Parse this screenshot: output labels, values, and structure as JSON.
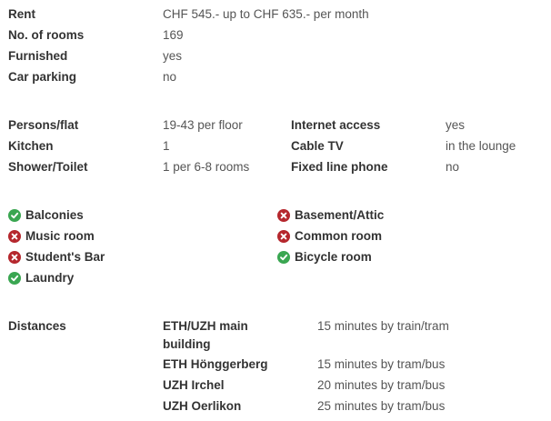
{
  "details": {
    "rent_label": "Rent",
    "rent_value": "CHF 545.- up to CHF 635.- per month",
    "rooms_label": "No. of rooms",
    "rooms_value": "169",
    "furnished_label": "Furnished",
    "furnished_value": "yes",
    "parking_label": "Car parking",
    "parking_value": "no"
  },
  "facilities": {
    "persons_label": "Persons/flat",
    "persons_value": "19-43 per floor",
    "kitchen_label": "Kitchen",
    "kitchen_value": "1",
    "shower_label": "Shower/Toilet",
    "shower_value": "1 per 6-8 rooms",
    "internet_label": "Internet access",
    "internet_value": "yes",
    "cable_label": "Cable TV",
    "cable_value": "in the lounge",
    "phone_label": "Fixed line phone",
    "phone_value": "no"
  },
  "features": {
    "colors": {
      "yes": "#3aa651",
      "no": "#b5272d"
    },
    "items": [
      {
        "label": "Balconies",
        "available": true,
        "icon": "check-circle-icon"
      },
      {
        "label": "Music room",
        "available": false,
        "icon": "x-circle-icon"
      },
      {
        "label": "Student's Bar",
        "available": false,
        "icon": "x-circle-icon"
      },
      {
        "label": "Laundry",
        "available": true,
        "icon": "check-circle-icon"
      },
      {
        "label": "Basement/Attic",
        "available": false,
        "icon": "x-circle-icon"
      },
      {
        "label": "Common room",
        "available": false,
        "icon": "x-circle-icon"
      },
      {
        "label": "Bicycle room",
        "available": true,
        "icon": "check-circle-icon"
      }
    ]
  },
  "distances": {
    "label": "Distances",
    "rows": [
      {
        "place": "ETH/UZH main building",
        "time": "15 minutes by train/tram"
      },
      {
        "place": "ETH Hönggerberg",
        "time": "15 minutes by tram/bus"
      },
      {
        "place": "UZH Irchel",
        "time": "20 minutes by tram/bus"
      },
      {
        "place": "UZH Oerlikon",
        "time": "25 minutes by tram/bus"
      }
    ]
  }
}
